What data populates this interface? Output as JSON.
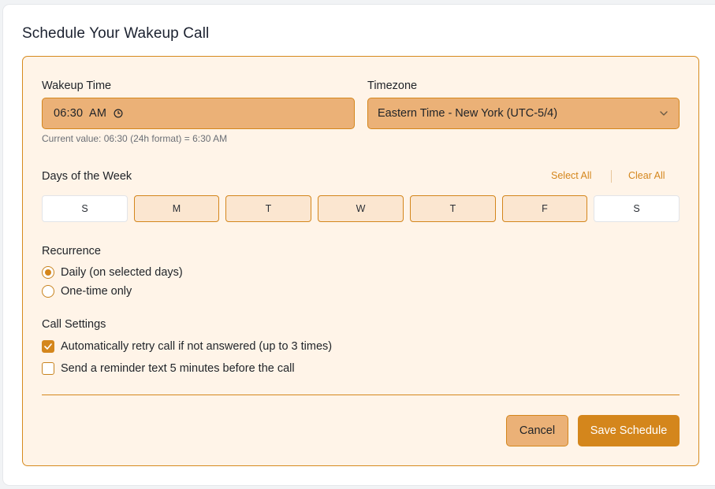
{
  "page": {
    "title": "Schedule Your Wakeup Call"
  },
  "wakeup": {
    "label": "Wakeup Time",
    "value": "06:30  AM",
    "helper": "Current value: 06:30 (24h format) = 6:30 AM"
  },
  "timezone": {
    "label": "Timezone",
    "selected": "Eastern Time - New York (UTC-5/4)"
  },
  "days": {
    "label": "Days of the Week",
    "select_all": "Select All",
    "clear_all": "Clear All",
    "items": [
      {
        "label": "S",
        "selected": false
      },
      {
        "label": "M",
        "selected": true
      },
      {
        "label": "T",
        "selected": true
      },
      {
        "label": "W",
        "selected": true
      },
      {
        "label": "T",
        "selected": true
      },
      {
        "label": "F",
        "selected": true
      },
      {
        "label": "S",
        "selected": false
      }
    ]
  },
  "recurrence": {
    "label": "Recurrence",
    "options": [
      {
        "label": "Daily (on selected days)",
        "selected": true
      },
      {
        "label": "One-time only",
        "selected": false
      }
    ]
  },
  "settings": {
    "label": "Call Settings",
    "options": [
      {
        "label": "Automatically retry call if not answered (up to 3 times)",
        "checked": true
      },
      {
        "label": "Send a reminder text 5 minutes before the call",
        "checked": false
      }
    ]
  },
  "actions": {
    "cancel": "Cancel",
    "save": "Save Schedule"
  },
  "colors": {
    "accent": "#d4861c",
    "panel_bg": "#fff4e8",
    "field_bg": "#ebb177"
  }
}
